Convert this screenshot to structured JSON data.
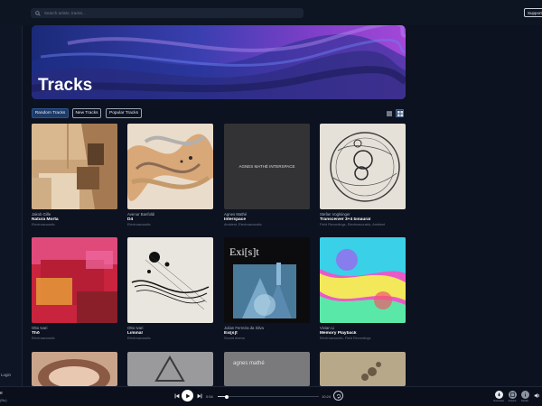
{
  "search": {
    "placeholder": "Search artists, tracks..."
  },
  "header": {
    "support_label": "Support"
  },
  "sidebar": {
    "login_label": "Login"
  },
  "hero": {
    "title": "Tracks"
  },
  "filters": [
    {
      "label": "Random Tracks",
      "active": true
    },
    {
      "label": "New Tracks",
      "active": false
    },
    {
      "label": "Popular Tracks",
      "active": false
    }
  ],
  "view_toggle": {
    "list": "list-view-icon",
    "grid": "grid-view-icon",
    "active": "grid"
  },
  "tracks": [
    {
      "artist": "Jakob Gille",
      "title": "Natura Morta",
      "tags": "Electroacoustic"
    },
    {
      "artist": "Avenur Banfoldi",
      "title": "D4",
      "tags": "Electroacoustic"
    },
    {
      "artist": "Agnes Mathé",
      "title": "Interspace",
      "tags": "Ambient, Electroacoustic"
    },
    {
      "artist": "Stefan Voglsinger",
      "title": "Transceiver 3+4 binaural",
      "tags": "Field Recordings, Electroacoustic, Ambient"
    },
    {
      "artist": "Otto Ivari",
      "title": "Thō",
      "tags": "Electroacoustic"
    },
    {
      "artist": "Otto Ivari",
      "title": "Liminal",
      "tags": "Electroacoustic"
    },
    {
      "artist": "Julian Ferreira da Silva",
      "title": "Exi[s]t",
      "tags": "Sound drama"
    },
    {
      "artist": "Vivian Li",
      "title": "Memory Playback",
      "tags": "Electroacoustic, Field Recordings"
    }
  ],
  "covers": {
    "interspace_text": "AGNES MATHÉ   INTERSPACE",
    "exist_text": "Exi[s]t",
    "row3_text": "agnes mathé"
  },
  "player": {
    "now_playing_title": "e",
    "now_playing_sub": "(Bu)",
    "elapsed": "0:54",
    "duration": "10:24",
    "progress": 0.09,
    "right_labels": [
      "Download",
      "Artwork",
      "Details"
    ]
  }
}
